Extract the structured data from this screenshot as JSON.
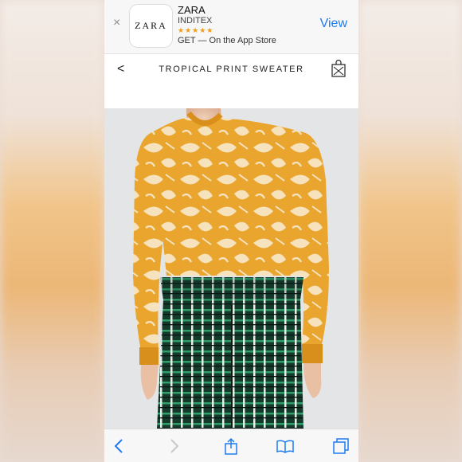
{
  "banner": {
    "close_glyph": "×",
    "app_icon_text": "ZARA",
    "app_name": "ZARA",
    "developer": "INDITEX",
    "stars": "★★★★★",
    "get_text": "GET — On the App Store",
    "view_label": "View"
  },
  "nav": {
    "back_glyph": "<",
    "title": "TROPICAL PRINT SWEATER",
    "bag_icon": "shopping-bag-icon"
  },
  "product": {
    "image": "model-wearing-tropical-print-sweater-and-checked-shorts"
  },
  "toolbar": {
    "icons": [
      "back-icon",
      "forward-icon",
      "share-icon",
      "bookmarks-icon",
      "tabs-icon"
    ]
  },
  "colors": {
    "accent": "#1e7cf2",
    "sweater": "#eaa52e",
    "shorts": "#143a2c",
    "background": "#e4e5e7"
  }
}
